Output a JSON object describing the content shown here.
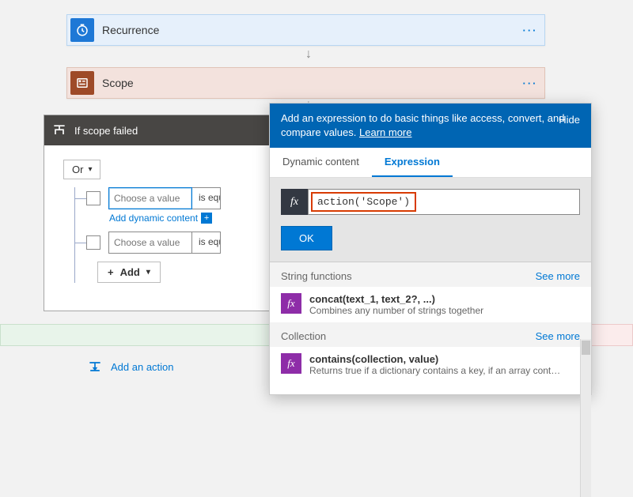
{
  "recurrence": {
    "label": "Recurrence"
  },
  "scope": {
    "label": "Scope"
  },
  "ifcard": {
    "title": "If scope failed",
    "or_label": "Or",
    "rows": [
      {
        "placeholder": "Choose a value",
        "op": "is equal to"
      },
      {
        "placeholder": "Choose a value",
        "op": "is equal to"
      }
    ],
    "dyn_link": "Add dynamic content",
    "add_label": "Add"
  },
  "addaction": {
    "label": "Add an action"
  },
  "panel": {
    "header_line": "Add an expression to do basic things like access, convert, and compare values.",
    "learn_more": "Learn more",
    "hide": "Hide",
    "tabs": {
      "dynamic": "Dynamic content",
      "expression": "Expression"
    },
    "expr_value": "action('Scope')",
    "ok": "OK",
    "categories": [
      {
        "name": "String functions",
        "see_more": "See more",
        "fn": {
          "sig": "concat(text_1, text_2?, ...)",
          "desc": "Combines any number of strings together"
        }
      },
      {
        "name": "Collection",
        "see_more": "See more",
        "fn": {
          "sig": "contains(collection, value)",
          "desc": "Returns true if a dictionary contains a key, if an array cont…"
        }
      }
    ]
  }
}
